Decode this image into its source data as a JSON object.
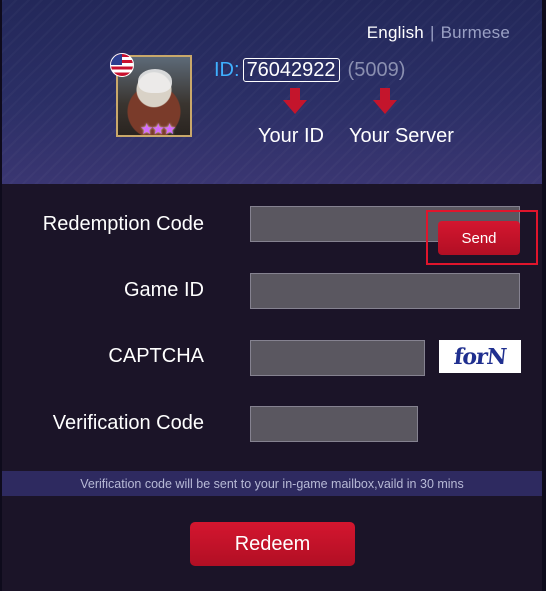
{
  "header": {
    "languages": [
      "English",
      "Burmese"
    ],
    "language_separator": "|",
    "id_label": "ID:",
    "id_value": "76042922",
    "server_value": "(5009)",
    "caption_id": "Your ID",
    "caption_server": "Your Server",
    "avatar_flag": "us-flag",
    "arrow_color": "#c4152c"
  },
  "form": {
    "redemption_code_label": "Redemption Code",
    "game_id_label": "Game ID",
    "captcha_label": "CAPTCHA",
    "verification_code_label": "Verification Code",
    "captcha_text": "forN",
    "send_label": "Send"
  },
  "notice": "Verification code will be sent to your in-game mailbox,vaild in 30 mins",
  "redeem_label": "Redeem",
  "colors": {
    "accent_red": "#c4152c",
    "id_label_blue": "#3fb0ff",
    "highlight_border": "#e0152c"
  }
}
